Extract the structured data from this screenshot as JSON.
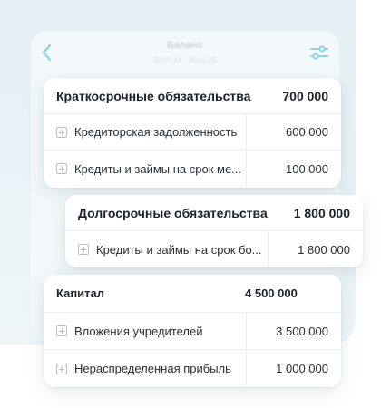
{
  "header": {
    "title": "Баланс",
    "subtitle": "20.07.24 - 20.02.25"
  },
  "cards": [
    {
      "title": "Краткосрочные обязательства",
      "value": "700 000",
      "rows": [
        {
          "name": "Кредиторская задолженность",
          "value": "600 000"
        },
        {
          "name": "Кредиты и займы на срок ме...",
          "value": "100 000"
        }
      ]
    },
    {
      "title": "Долгосрочные обязательства",
      "value": "1 800 000",
      "rows": [
        {
          "name": "Кредиты и займы на срок бо...",
          "value": "1 800 000"
        }
      ]
    },
    {
      "title": "Капитал",
      "value": "4 500 000",
      "rows": [
        {
          "name": "Вложения учредителей",
          "value": "3 500 000"
        },
        {
          "name": "Нераспределенная прибыль",
          "value": "1 000 000"
        }
      ]
    }
  ],
  "colors": {
    "accent": "#1aa3c9",
    "background_tint": "#e6f1f5"
  },
  "icons": [
    "back-chevron-icon",
    "filter-sliders-icon",
    "expand-plus-icon"
  ]
}
